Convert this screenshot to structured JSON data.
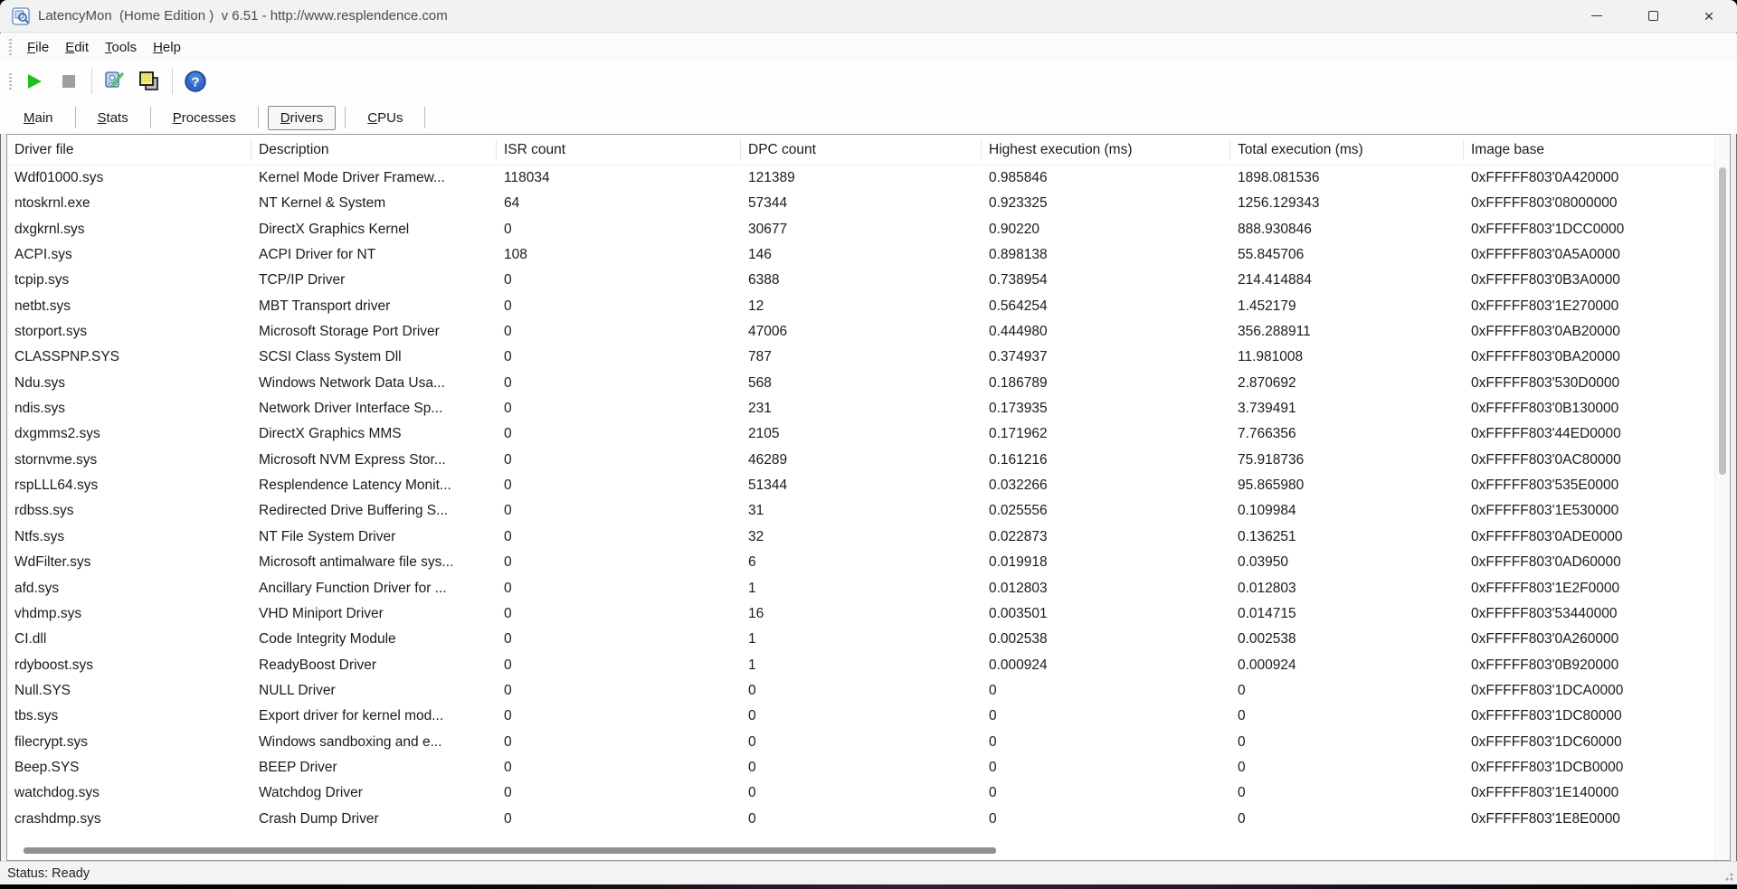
{
  "window": {
    "title": "LatencyMon  (Home Edition )  v 6.51 - http://www.resplendence.com"
  },
  "menu": {
    "items": [
      "File",
      "Edit",
      "Tools",
      "Help"
    ]
  },
  "toolbar": {
    "icons": [
      "play-icon",
      "stop-icon",
      "report-options-icon",
      "copy-icon",
      "help-icon"
    ]
  },
  "tabs": {
    "items": [
      "Main",
      "Stats",
      "Processes",
      "Drivers",
      "CPUs"
    ],
    "active": "Drivers"
  },
  "table": {
    "columns": [
      "Driver file",
      "Description",
      "ISR count",
      "DPC count",
      "Highest execution (ms)",
      "Total execution (ms)",
      "Image base"
    ],
    "column_keys": [
      "driver_file",
      "description",
      "isr_count",
      "dpc_count",
      "highest_execution_ms",
      "total_execution_ms",
      "image_base"
    ],
    "rows": [
      [
        "Wdf01000.sys",
        "Kernel Mode Driver Framew...",
        "118034",
        "121389",
        "0.985846",
        "1898.081536",
        "0xFFFFF803'0A420000"
      ],
      [
        "ntoskrnl.exe",
        "NT Kernel & System",
        "64",
        "57344",
        "0.923325",
        "1256.129343",
        "0xFFFFF803'08000000"
      ],
      [
        "dxgkrnl.sys",
        "DirectX Graphics Kernel",
        "0",
        "30677",
        "0.90220",
        "888.930846",
        "0xFFFFF803'1DCC0000"
      ],
      [
        "ACPI.sys",
        "ACPI Driver for NT",
        "108",
        "146",
        "0.898138",
        "55.845706",
        "0xFFFFF803'0A5A0000"
      ],
      [
        "tcpip.sys",
        "TCP/IP Driver",
        "0",
        "6388",
        "0.738954",
        "214.414884",
        "0xFFFFF803'0B3A0000"
      ],
      [
        "netbt.sys",
        "MBT Transport driver",
        "0",
        "12",
        "0.564254",
        "1.452179",
        "0xFFFFF803'1E270000"
      ],
      [
        "storport.sys",
        "Microsoft Storage Port Driver",
        "0",
        "47006",
        "0.444980",
        "356.288911",
        "0xFFFFF803'0AB20000"
      ],
      [
        "CLASSPNP.SYS",
        "SCSI Class System Dll",
        "0",
        "787",
        "0.374937",
        "11.981008",
        "0xFFFFF803'0BA20000"
      ],
      [
        "Ndu.sys",
        "Windows Network Data Usa...",
        "0",
        "568",
        "0.186789",
        "2.870692",
        "0xFFFFF803'530D0000"
      ],
      [
        "ndis.sys",
        "Network Driver Interface Sp...",
        "0",
        "231",
        "0.173935",
        "3.739491",
        "0xFFFFF803'0B130000"
      ],
      [
        "dxgmms2.sys",
        "DirectX Graphics MMS",
        "0",
        "2105",
        "0.171962",
        "7.766356",
        "0xFFFFF803'44ED0000"
      ],
      [
        "stornvme.sys",
        "Microsoft NVM Express Stor...",
        "0",
        "46289",
        "0.161216",
        "75.918736",
        "0xFFFFF803'0AC80000"
      ],
      [
        "rspLLL64.sys",
        "Resplendence Latency Monit...",
        "0",
        "51344",
        "0.032266",
        "95.865980",
        "0xFFFFF803'535E0000"
      ],
      [
        "rdbss.sys",
        "Redirected Drive Buffering S...",
        "0",
        "31",
        "0.025556",
        "0.109984",
        "0xFFFFF803'1E530000"
      ],
      [
        "Ntfs.sys",
        "NT File System Driver",
        "0",
        "32",
        "0.022873",
        "0.136251",
        "0xFFFFF803'0ADE0000"
      ],
      [
        "WdFilter.sys",
        "Microsoft antimalware file sys...",
        "0",
        "6",
        "0.019918",
        "0.03950",
        "0xFFFFF803'0AD60000"
      ],
      [
        "afd.sys",
        "Ancillary Function Driver for ...",
        "0",
        "1",
        "0.012803",
        "0.012803",
        "0xFFFFF803'1E2F0000"
      ],
      [
        "vhdmp.sys",
        "VHD Miniport Driver",
        "0",
        "16",
        "0.003501",
        "0.014715",
        "0xFFFFF803'53440000"
      ],
      [
        "CI.dll",
        "Code Integrity Module",
        "0",
        "1",
        "0.002538",
        "0.002538",
        "0xFFFFF803'0A260000"
      ],
      [
        "rdyboost.sys",
        "ReadyBoost Driver",
        "0",
        "1",
        "0.000924",
        "0.000924",
        "0xFFFFF803'0B920000"
      ],
      [
        "Null.SYS",
        "NULL Driver",
        "0",
        "0",
        "0",
        "0",
        "0xFFFFF803'1DCA0000"
      ],
      [
        "tbs.sys",
        "Export driver for kernel mod...",
        "0",
        "0",
        "0",
        "0",
        "0xFFFFF803'1DC80000"
      ],
      [
        "filecrypt.sys",
        "Windows sandboxing and e...",
        "0",
        "0",
        "0",
        "0",
        "0xFFFFF803'1DC60000"
      ],
      [
        "Beep.SYS",
        "BEEP Driver",
        "0",
        "0",
        "0",
        "0",
        "0xFFFFF803'1DCB0000"
      ],
      [
        "watchdog.sys",
        "Watchdog Driver",
        "0",
        "0",
        "0",
        "0",
        "0xFFFFF803'1E140000"
      ],
      [
        "crashdmp.sys",
        "Crash Dump Driver",
        "0",
        "0",
        "0",
        "0",
        "0xFFFFF803'1E8E0000"
      ]
    ]
  },
  "statusbar": {
    "text": "Status: Ready"
  },
  "colors": {
    "chrome_bg": "#f0f0f0",
    "list_bg": "#ffffff",
    "play_green": "#1fbf1f",
    "stop_gray": "#9f9f9f",
    "copy_yellow": "#f2ef7a",
    "help_blue": "#2e66c9"
  }
}
